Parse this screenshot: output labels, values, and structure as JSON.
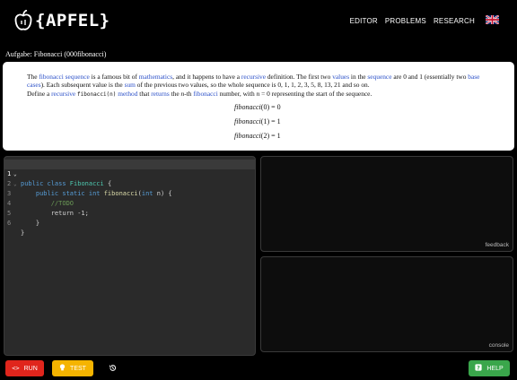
{
  "header": {
    "logo_text": "{APFEL}",
    "nav": [
      "EDITOR",
      "PROBLEMS",
      "RESEARCH"
    ],
    "language_flag": "uk-flag-icon"
  },
  "task": {
    "title": "Aufgabe: Fibonacci (000fibonacci)"
  },
  "description": {
    "p1": {
      "t1": "The ",
      "l1": "fibonacci sequence",
      "t2": " is a famous bit of ",
      "l2": "mathematics",
      "t3": ", and it happens to have a ",
      "l3": "recursive",
      "t4": " definition. The first two ",
      "l4": "values",
      "t5": " in the ",
      "l5": "sequence",
      "t6": " are 0 and 1 (essentially two ",
      "l6": "base cases",
      "t7": "). Each subsequent value is the ",
      "l7": "sum",
      "t8": " of the previous two values, so the whole sequence is 0, 1, 1, 2, 3, 5, 8, 13, 21 and so on."
    },
    "p2": {
      "t1": "Define a ",
      "l1": "recursive",
      "t2": " ",
      "code": "fibonacci(n)",
      "t3": " ",
      "l2": "method",
      "t4": " that ",
      "l3": "returns",
      "t5": " the ",
      "math": "n",
      "t6": "-th ",
      "l4": "fibonacci",
      "t7": " number, with ",
      "math2": "n",
      "t8": " = 0 representing the start of the sequence."
    },
    "equations": [
      {
        "lhs": "fibonacci",
        "arg": "(0)",
        "rhs": " = 0"
      },
      {
        "lhs": "fibonacci",
        "arg": "(1)",
        "rhs": " = 1"
      },
      {
        "lhs": "fibonacci",
        "arg": "(2)",
        "rhs": " = 1"
      }
    ]
  },
  "editor": {
    "active_line": 1,
    "lines": [
      {
        "n": "1",
        "fold": "⌄"
      },
      {
        "n": "2",
        "fold": "⌄"
      },
      {
        "n": "3",
        "fold": ""
      },
      {
        "n": "4",
        "fold": ""
      },
      {
        "n": "5",
        "fold": ""
      },
      {
        "n": "6",
        "fold": ""
      }
    ],
    "tokens": {
      "l1_kw": "public class ",
      "l1_ty": "Fibonacci",
      "l1_pl": " {",
      "l2_ind": "    ",
      "l2_kw": "public static int ",
      "l2_fn": "fibonacci",
      "l2_p1": "(",
      "l2_kw2": "int",
      "l2_p2": " n) {",
      "l3_ind": "        ",
      "l3_cm": "//TODO",
      "l4_ind": "        ",
      "l4_pl": "return -1;",
      "l5_pl": "    }",
      "l6_pl": "}"
    }
  },
  "panels": {
    "feedback_label": "feedback",
    "console_label": "console"
  },
  "buttons": {
    "run": "RUN",
    "test": "TEST",
    "help": "HELP"
  },
  "colors": {
    "run": "#e0251c",
    "test": "#f5b400",
    "help": "#3aa64b",
    "link": "#2b50c8"
  }
}
